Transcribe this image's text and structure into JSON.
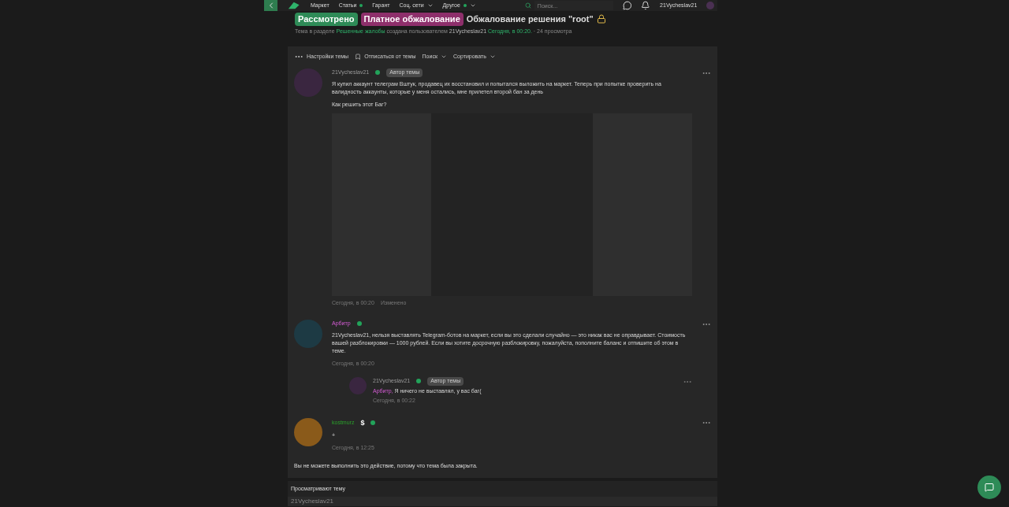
{
  "header": {
    "nav": [
      {
        "label": "Маркет",
        "dot": false,
        "dropdown": false
      },
      {
        "label": "Статьи",
        "dot": true,
        "dropdown": false
      },
      {
        "label": "Гарант",
        "dot": false,
        "dropdown": false
      },
      {
        "label": "Соц. сети",
        "dot": false,
        "dropdown": true
      },
      {
        "label": "Другое",
        "dot": true,
        "dropdown": true
      }
    ],
    "search": {
      "placeholder": "Поиск..."
    },
    "username": "21Vycheslav21"
  },
  "thread": {
    "tags": [
      {
        "label": "Рассмотрено",
        "color": "#2e8b57"
      },
      {
        "label": "Платное обжалование",
        "color": "#8e2f6b"
      }
    ],
    "title": "Обжалование решения \"root\"",
    "locked": true,
    "meta": {
      "prefix": "Тема в разделе",
      "section": "Решенные жалобы",
      "middle": "создана пользователем",
      "author": "21Vycheslav21",
      "date": "Сегодня, в 00:20.",
      "views": "· 24 просмотра"
    }
  },
  "toolbar": [
    {
      "label": "Настройки темы",
      "kind": "settings",
      "dropdown": false
    },
    {
      "label": "Отписаться от темы",
      "kind": "unsubscribe",
      "dropdown": false
    },
    {
      "label": "Поиск",
      "kind": "menu",
      "dropdown": true
    },
    {
      "label": "Сортировать",
      "kind": "menu",
      "dropdown": true
    }
  ],
  "posts": [
    {
      "author": "21Vycheslav21",
      "kind": "author",
      "online": true,
      "badge": "Автор темы",
      "paragraphs": [
        "Я купил аккаунт телеграм Вштук, продавец их восстановил и попытался выложить на маркет. Теперь при попытке проверить на валидность аккаунты, которые у меня остались, мне прилетел второй бан за день",
        "Как решить этот Баг?"
      ],
      "screenshot": true,
      "time": "Сегодня, в 00:20",
      "edited": "Изменено"
    },
    {
      "author": "Арбитр",
      "kind": "arbiter",
      "online": true,
      "paragraphs": [
        "21Vycheslav21, нельзя выставлять Telegram-ботов на маркет, если вы это сделали случайно — это никак вас не оправдывает. Стоимость вашей разблокировки — 1000 рублей. Если вы хотите досрочную разблокировку, пожалуйста, пополните баланс и отпишите об этом в теме."
      ],
      "time": "Сегодня, в 00:20",
      "replies": [
        {
          "author": "21Vycheslav21",
          "kind": "author",
          "online": true,
          "badge": "Автор темы",
          "mention": "Арбитр,",
          "text": "Я ничего не выставлял, у вас баг(",
          "time": "Сегодня, в 00:22"
        }
      ]
    },
    {
      "author": "kostmurz",
      "kind": "member",
      "dollar": true,
      "dollar_text": "$",
      "online": true,
      "paragraphs": [
        "+"
      ],
      "time": "Сегодня, в 12:25"
    }
  ],
  "closed_notice": "Вы не можете выполнить это действие, потому что тема была закрыта.",
  "viewers": {
    "title": "Просматривают тему",
    "first": "21Vycheslav21"
  }
}
